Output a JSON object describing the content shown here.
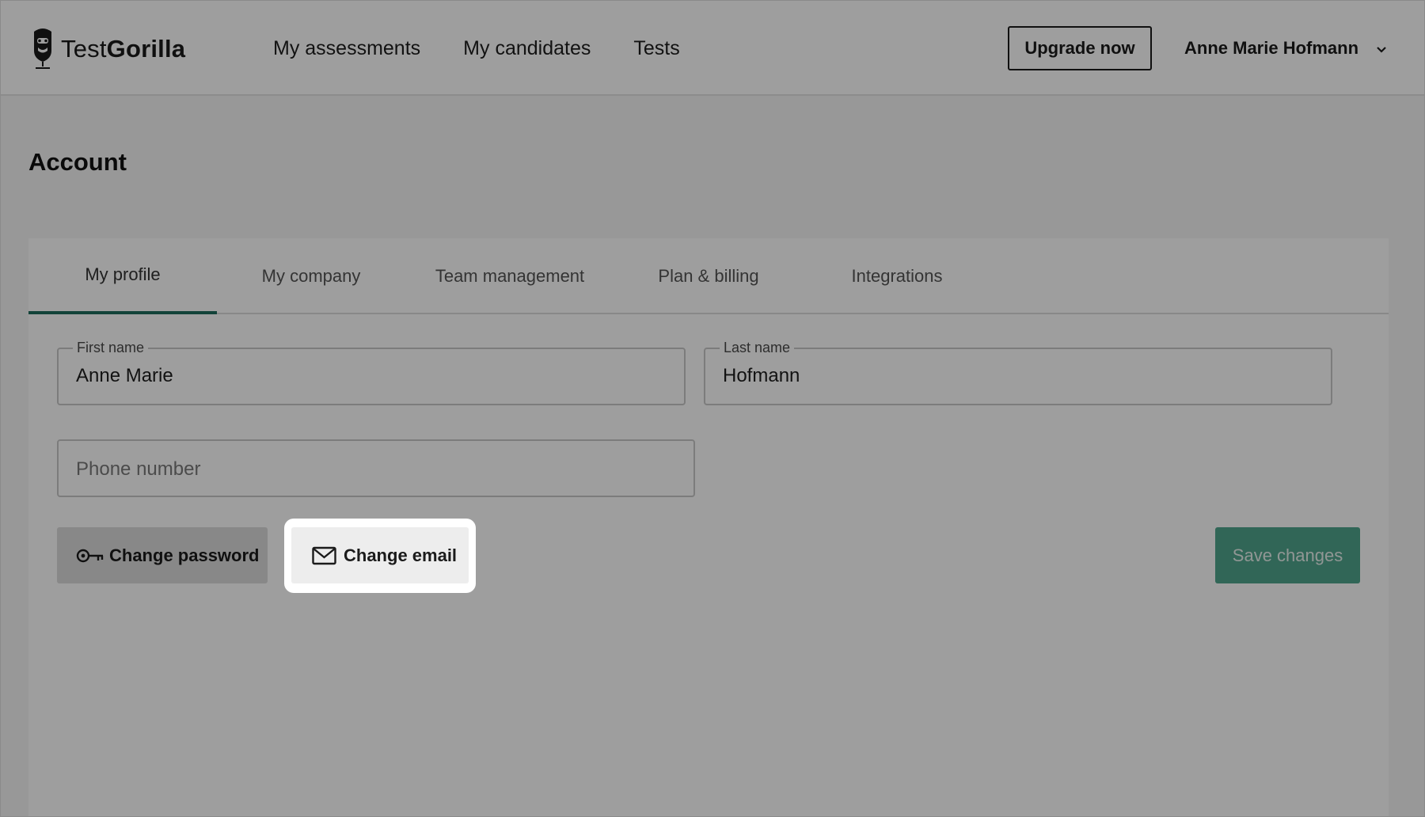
{
  "header": {
    "logo_text_light": "Test",
    "logo_text_bold": "Gorilla",
    "nav": [
      {
        "label": "My assessments"
      },
      {
        "label": "My candidates"
      },
      {
        "label": "Tests"
      }
    ],
    "upgrade_label": "Upgrade now",
    "user_name": "Anne Marie Hofmann",
    "user_menu_icon": "chevron-down-icon"
  },
  "page": {
    "title": "Account"
  },
  "tabs": [
    {
      "label": "My profile",
      "active": true
    },
    {
      "label": "My company",
      "active": false
    },
    {
      "label": "Team management",
      "active": false
    },
    {
      "label": "Plan & billing",
      "active": false
    },
    {
      "label": "Integrations",
      "active": false
    }
  ],
  "form": {
    "first_name": {
      "label": "First name",
      "value": "Anne Marie"
    },
    "last_name": {
      "label": "Last name",
      "value": "Hofmann"
    },
    "phone": {
      "placeholder": "Phone number",
      "value": ""
    }
  },
  "actions": {
    "change_password": {
      "label": "Change password",
      "icon": "key-icon"
    },
    "change_email": {
      "label": "Change email",
      "icon": "mail-icon"
    },
    "save": {
      "label": "Save changes"
    }
  },
  "colors": {
    "accent": "#1e6b5d",
    "save_button": "#4fa58d",
    "overlay": "rgba(0,0,0,0.38)"
  }
}
